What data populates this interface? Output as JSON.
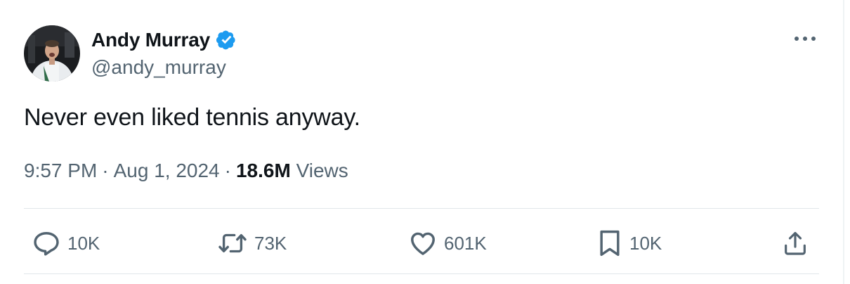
{
  "author": {
    "display_name": "Andy Murray",
    "handle": "@andy_murray",
    "verified": true
  },
  "tweet": {
    "text": "Never even liked tennis anyway.",
    "time": "9:57 PM",
    "date": "Aug 1, 2024",
    "separator": "·",
    "views_count": "18.6M",
    "views_label": "Views"
  },
  "actions": {
    "replies": "10K",
    "reposts": "73K",
    "likes": "601K",
    "bookmarks": "10K"
  },
  "icons": {
    "avatar": "avatar-photo",
    "verified": "verified-badge-icon",
    "more": "more-options-icon",
    "reply": "reply-icon",
    "repost": "repost-icon",
    "like": "heart-icon",
    "bookmark": "bookmark-icon",
    "share": "share-icon"
  },
  "colors": {
    "text_primary": "#0f1419",
    "text_secondary": "#536471",
    "verified_blue": "#1d9bf0",
    "divider": "#e1e6ea"
  }
}
